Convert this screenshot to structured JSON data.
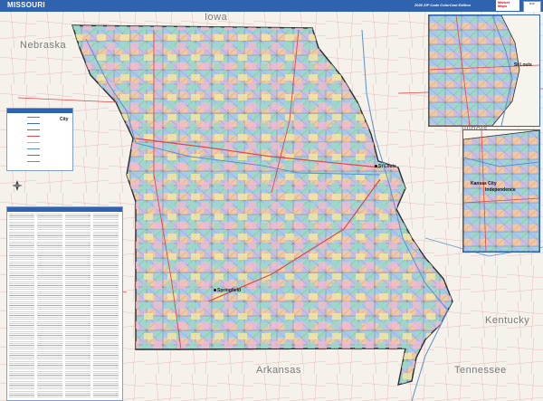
{
  "header": {
    "title": "MISSOURI",
    "edition": "2020 ZIP Code ColorCast Edition",
    "logo_text": "Market Maps",
    "badge_text": "MAP"
  },
  "map": {
    "state_labels": {
      "iowa": "Iowa",
      "nebraska": "Nebraska",
      "illinois": "Illinois",
      "kentucky": "Kentucky",
      "tennessee": "Tennessee",
      "arkansas": "Arkansas"
    },
    "cities": {
      "springfield": "Springfield",
      "st_louis": "St Louis",
      "kansas_city": "Kansas City",
      "independence": "Independence"
    },
    "colors": {
      "header": "#2f63b0",
      "missouri_boundary": "#2b2b2b",
      "highways": "#d94a4a",
      "county_blue": "#a9c9ea",
      "county_teal": "#9fd8c8",
      "county_peach": "#f2c9a6",
      "county_lavender": "#c9bfe6",
      "county_yellow": "#f2e7a6",
      "county_pink": "#f0bcd0"
    }
  },
  "legend": {
    "city_label": "City"
  },
  "compass": {
    "north": "N"
  }
}
